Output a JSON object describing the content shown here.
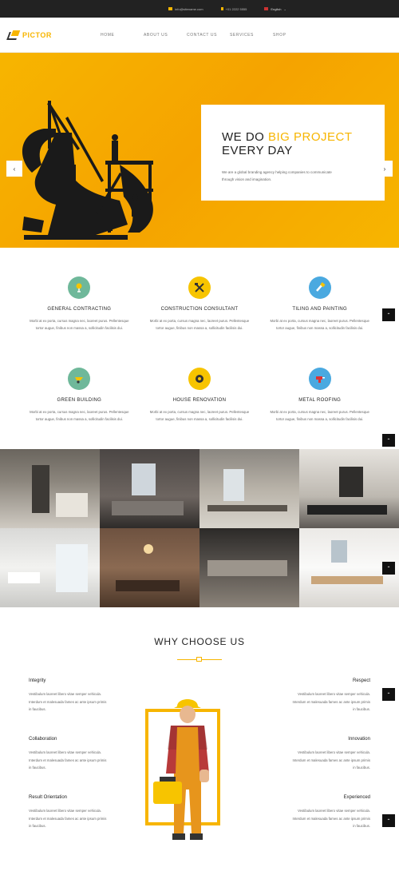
{
  "topbar": {
    "email": "info@sitename.com",
    "phone": "+01 2222 5555",
    "language": "English"
  },
  "header": {
    "logo": "PICTOR",
    "nav": [
      "HOME",
      "ABOUT US",
      "CONTACT US",
      "SERVICES",
      "SHOP"
    ]
  },
  "hero": {
    "title_line1_prefix": "WE DO ",
    "title_line1_highlight": "BIG PROJECT",
    "title_line2": "EVERY DAY",
    "text": "We are a global branding agency helping companies to communicate through vision and imagination.",
    "accent_color": "#f7b500"
  },
  "services": [
    {
      "title": "GENERAL CONTRACTING",
      "icon": "pin-hook-icon",
      "color": "#6fb89a",
      "text": "Morbi at ex porta, cursus magna nec, laoreet purus. Pellentesque tortor augue, finibus non massa a, sollicitudin facilisis dui."
    },
    {
      "title": "CONSTRUCTION CONSULTANT",
      "icon": "hammer-wrench-icon",
      "color": "#f7c400",
      "text": "Morbi at ex porta, cursus magna nec, laoreet purus. Pellentesque tortor augue, finibus non massa a, sollicitudin facilisis dui."
    },
    {
      "title": "TILING AND PAINTING",
      "icon": "paint-roller-icon",
      "color": "#4aa9e0",
      "text": "Morbi at ex porta, cursus magna nec, laoreet purus. Pellentesque tortor augue, finibus non massa a, sollicitudin facilisis dui."
    },
    {
      "title": "GREEN BUILDING",
      "icon": "wheelbarrow-icon",
      "color": "#6fb89a",
      "text": "Morbi at ex porta, cursus magna nec, laoreet purus. Pellentesque tortor augue, finibus non massa a, sollicitudin facilisis dui."
    },
    {
      "title": "HOUSE RENOVATION",
      "icon": "tape-measure-icon",
      "color": "#f7c400",
      "text": "Morbi at ex porta, cursus magna nec, laoreet purus. Pellentesque tortor augue, finibus non massa a, sollicitudin facilisis dui."
    },
    {
      "title": "METAL ROOFING",
      "icon": "drill-icon",
      "color": "#4aa9e0",
      "text": "Morbi at ex porta, cursus magna nec, laoreet purus. Pellentesque tortor augue, finibus non massa a, sollicitudin facilisis dui."
    }
  ],
  "why": {
    "title": "WHY CHOOSE US",
    "features_left": [
      {
        "title": "Integrity",
        "text": "Vestibulum laoreet libero vitae semper vehicula. Interdum et malesuada fames ac ante ipsum primis in faucibus."
      },
      {
        "title": "Collaboration",
        "text": "Vestibulum laoreet libero vitae semper vehicula. Interdum et malesuada fames ac ante ipsum primis in faucibus."
      },
      {
        "title": "Result Orientation",
        "text": "Vestibulum laoreet libero vitae semper vehicula. Interdum et malesuada fames ac ante ipsum primis in faucibus."
      }
    ],
    "features_right": [
      {
        "title": "Respect",
        "text": "Vestibulum laoreet libero vitae semper vehicula. Interdum et malesuada fames ac ante ipsum primis in faucibus."
      },
      {
        "title": "Innovation",
        "text": "Vestibulum laoreet libero vitae semper vehicula. Interdum et malesuada fames ac ante ipsum primis in faucibus."
      },
      {
        "title": "Experienced",
        "text": "Vestibulum laoreet libero vitae semper vehicula. Interdum et malesuada fames ac ante ipsum primis in faucibus."
      }
    ]
  }
}
